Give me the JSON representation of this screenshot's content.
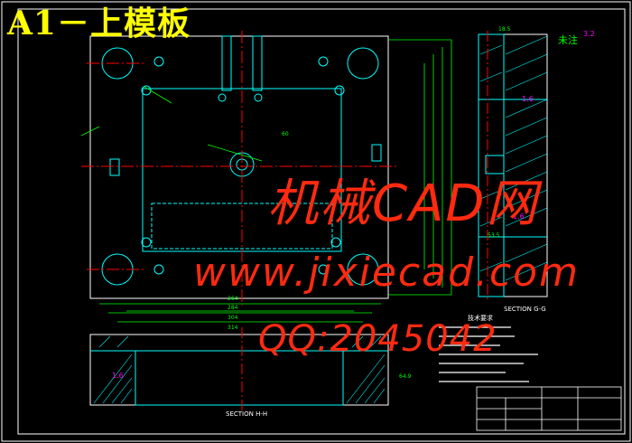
{
  "title": "A1－上模板",
  "watermark": {
    "line1": "机械CAD网",
    "line2": "www.jixiecad.com",
    "line3": "QQ:2045042"
  },
  "labels": {
    "section_gg": "SECTION G-G",
    "section_hh": "SECTION H-H",
    "note": "未注",
    "roughness_note": "3.2",
    "roughness_1": "1.6",
    "roughness_2": "1.6",
    "roughness_3": "1.6",
    "tech_title": "技术要求"
  },
  "dimensions": {
    "d1": "284",
    "d2": "304",
    "d3": "314",
    "d4": "264",
    "d5": "64.9",
    "d6": "53.5",
    "d7": "18.5",
    "d8": "60"
  },
  "colors": {
    "background": "#000000",
    "outline": "#ffffff",
    "part": "#00ffff",
    "center": "#ff0000",
    "dimension": "#00ff00",
    "title": "#ffff00",
    "watermark": "#ff2a10",
    "accent": "#ff00ff"
  }
}
